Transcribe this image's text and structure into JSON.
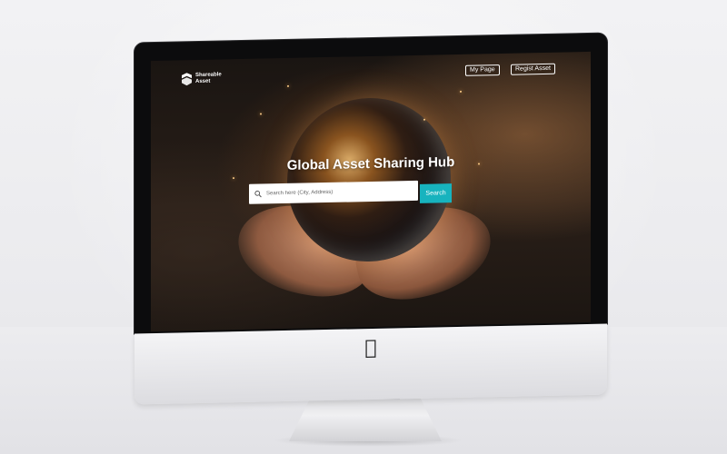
{
  "brand": {
    "name_line1": "Shareable",
    "name_line2": "Asset",
    "logo_icon": "shield-chevron-icon"
  },
  "nav": {
    "my_page": "My Page",
    "regist_asset": "Regist Asset"
  },
  "hero": {
    "title": "Global Asset Sharing Hub"
  },
  "search": {
    "placeholder": "Search here (City, Address)",
    "value": "",
    "button_label": "Search",
    "icon": "search-icon"
  },
  "colors": {
    "accent": "#17b3be",
    "bezel": "#0c0c0d",
    "text_on_dark": "#ffffff"
  }
}
